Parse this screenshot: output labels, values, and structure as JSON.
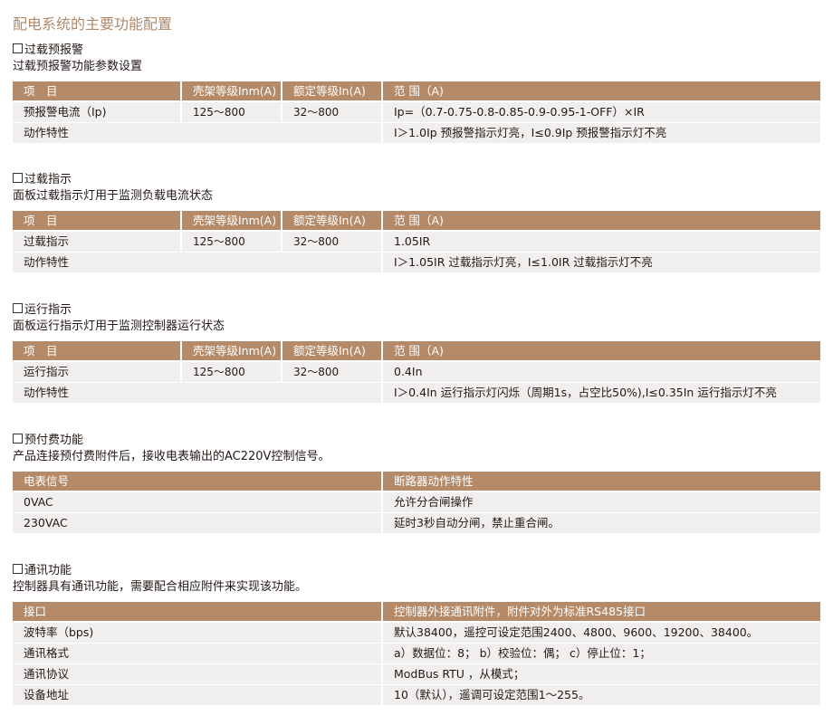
{
  "page_title": "配电系统的主要功能配置",
  "colors": {
    "header_bg": "#b58a68",
    "row_bg": "#f1efee",
    "title_color": "#b0896a"
  },
  "sections": [
    {
      "title": "过载预报警",
      "desc": "过载预报警功能参数设置",
      "headers": [
        "项　目",
        "壳架等级Inm(A)",
        "额定等级In(A)",
        "范 围（A)"
      ],
      "rows": [
        [
          "预报警电流（Ip)",
          "125～800",
          "32～800",
          "Ip=（0.7-0.75-0.8-0.85-0.9-0.95-1-OFF）×IR"
        ]
      ],
      "action": [
        "动作特性",
        "I＞1.0Ip  预报警指示灯亮，I≤0.9Ip  预报警指示灯不亮"
      ]
    },
    {
      "title": "过载指示",
      "desc": "面板过载指示灯用于监测负载电流状态",
      "headers": [
        "项　目",
        "壳架等级Inm(A)",
        "额定等级In(A)",
        "范 围（A)"
      ],
      "rows": [
        [
          "过载指示",
          "125～800",
          "32～800",
          "1.05IR"
        ]
      ],
      "action": [
        "动作特性",
        "I＞1.05IR  过载指示灯亮，I≤1.0IR  过载指示灯不亮"
      ]
    },
    {
      "title": "运行指示",
      "desc": "面板运行指示灯用于监测控制器运行状态",
      "headers": [
        "项　目",
        "壳架等级Inm(A)",
        "额定等级In(A)",
        "范 围（A)"
      ],
      "rows": [
        [
          "运行指示",
          "125～800",
          "32～800",
          "0.4In"
        ]
      ],
      "action": [
        "动作特性",
        "I＞0.4In 运行指示灯闪烁（周期1s，占空比50%),I≤0.35In  运行指示灯不亮"
      ]
    },
    {
      "title": "预付费功能",
      "desc": "产品连接预付费附件后，接收电表输出的AC220V控制信号。",
      "headers": [
        "电表信号",
        "断路器动作特性"
      ],
      "rows": [
        [
          "0VAC",
          "允许分合闸操作"
        ],
        [
          "230VAC",
          "延时3秒自动分闸，禁止重合闸。"
        ]
      ]
    },
    {
      "title": "通讯功能",
      "desc": "控制器具有通讯功能，需要配合相应附件来实现该功能。",
      "headers": [
        "接口",
        "控制器外接通讯附件，附件对外为标准RS485接口"
      ],
      "rows": [
        [
          "波特率（bps)",
          "默认38400，遥控可设定范围2400、4800、9600、19200、38400。"
        ],
        [
          "通讯格式",
          "a）数据位：8；  b）校验位：偶；  c）停止位：1；"
        ],
        [
          "通讯协议",
          "ModBus  RTU ，从模式；"
        ],
        [
          "设备地址",
          "10（默认），遥调可设定范围1～255。"
        ]
      ]
    }
  ]
}
